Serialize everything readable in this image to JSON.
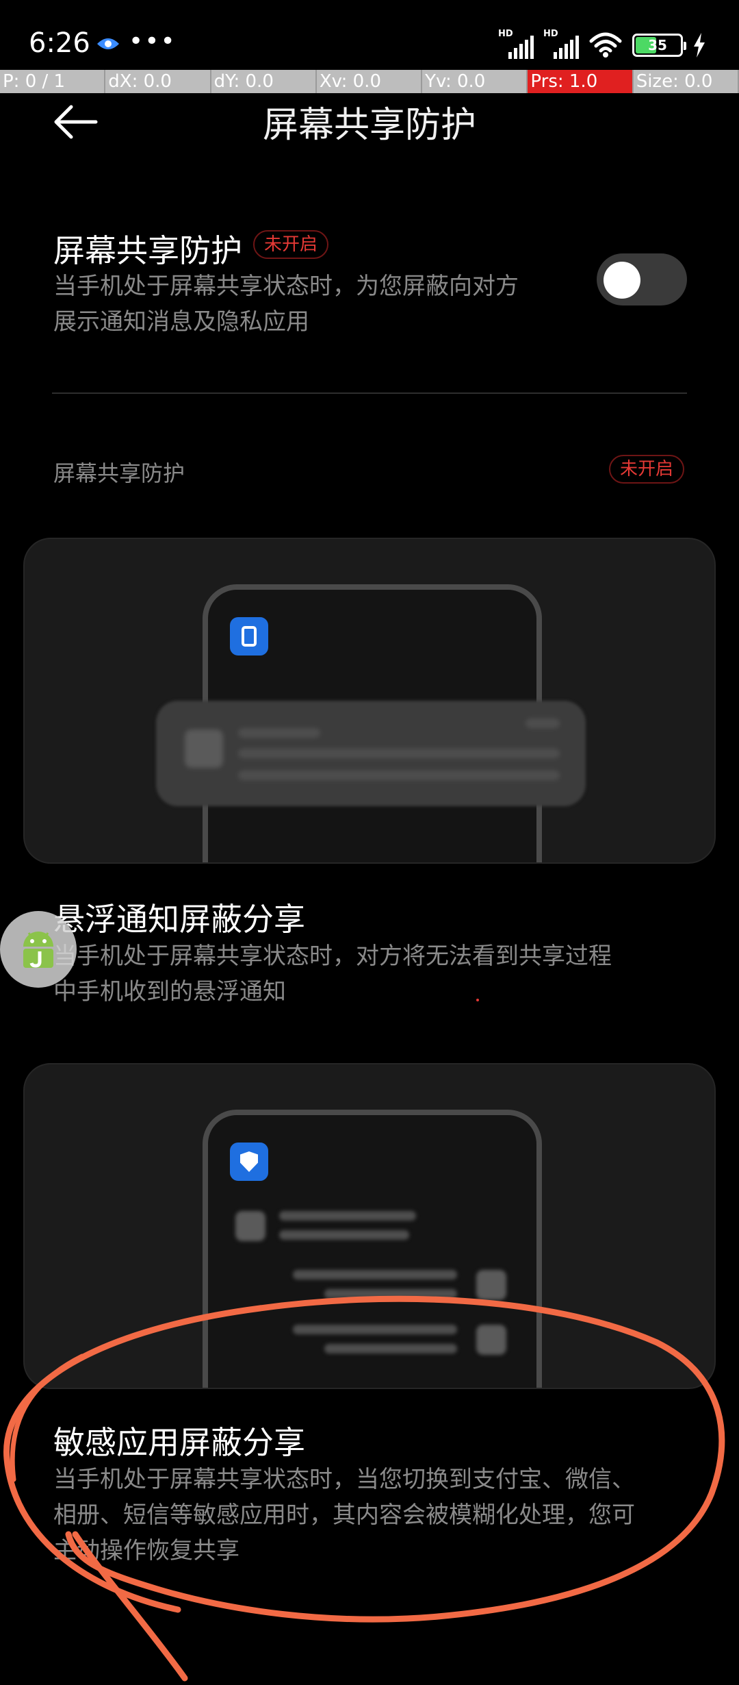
{
  "status_bar": {
    "time": "6:26",
    "overflow": "•••",
    "battery_level": "35",
    "signal1_label": "HD",
    "signal2_label": "HD",
    "icons": [
      "eye-icon",
      "signal-icon",
      "signal-icon",
      "wifi-icon",
      "battery-icon",
      "charging-icon"
    ]
  },
  "debug_bar": {
    "p": "P: 0 / 1",
    "dx": "dX: 0.0",
    "dy": "dY: 0.0",
    "xv": "Xv: 0.0",
    "yv": "Yv: 0.0",
    "prs": "Prs: 1.0",
    "size": "Size: 0.0",
    "highlight_color": "#e02020"
  },
  "header": {
    "title": "屏幕共享防护"
  },
  "setting": {
    "title": "屏幕共享防护",
    "badge": "未开启",
    "desc_line1": "当手机处于屏幕共享状态时，为您屏蔽向对方",
    "desc_line2": "展示通知消息及隐私应用",
    "toggle_on": false
  },
  "section": {
    "title": "屏幕共享防护",
    "badge": "未开启"
  },
  "features": [
    {
      "title": "悬浮通知屏蔽分享",
      "desc_line1": "当手机处于屏幕共享状态时，对方将无法看到共享过程",
      "desc_line2": "中手机收到的悬浮通知"
    },
    {
      "title": "敏感应用屏蔽分享",
      "desc_line1": "当手机处于屏幕共享状态时，当您切换到支付宝、微信、",
      "desc_line2": "相册、短信等敏感应用时，其内容会被模糊化处理，您可",
      "desc_line3": "主动操作恢复共享"
    }
  ],
  "colors": {
    "accent_red": "#e53935",
    "annotation": "#f26a45",
    "app_blue": "#1f6fe0"
  }
}
